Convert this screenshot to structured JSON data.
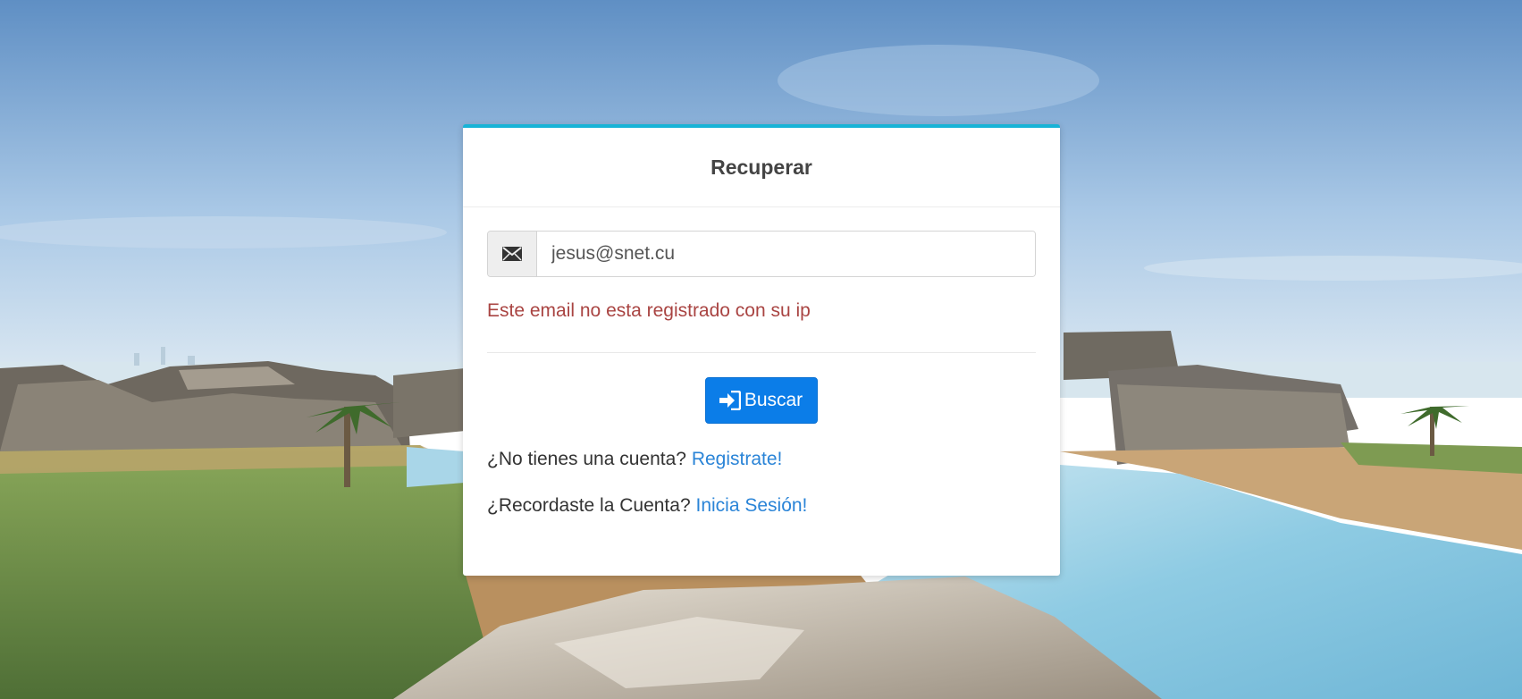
{
  "card": {
    "title": "Recuperar"
  },
  "email": {
    "value": "jesus@snet.cu",
    "icon": "envelope-icon"
  },
  "error": {
    "message": "Este email no esta registrado con su ip"
  },
  "search_button": {
    "label": "Buscar",
    "icon": "sign-in-icon"
  },
  "register": {
    "prompt": "¿No tienes una cuenta?",
    "link": "Registrate!"
  },
  "login": {
    "prompt": "¿Recordaste la Cuenta?",
    "link": "Inicia Sesión!"
  },
  "colors": {
    "accent_top_border": "#17b3d6",
    "primary_button": "#0b7de8",
    "error_text": "#a94442",
    "link": "#2a84d7"
  }
}
